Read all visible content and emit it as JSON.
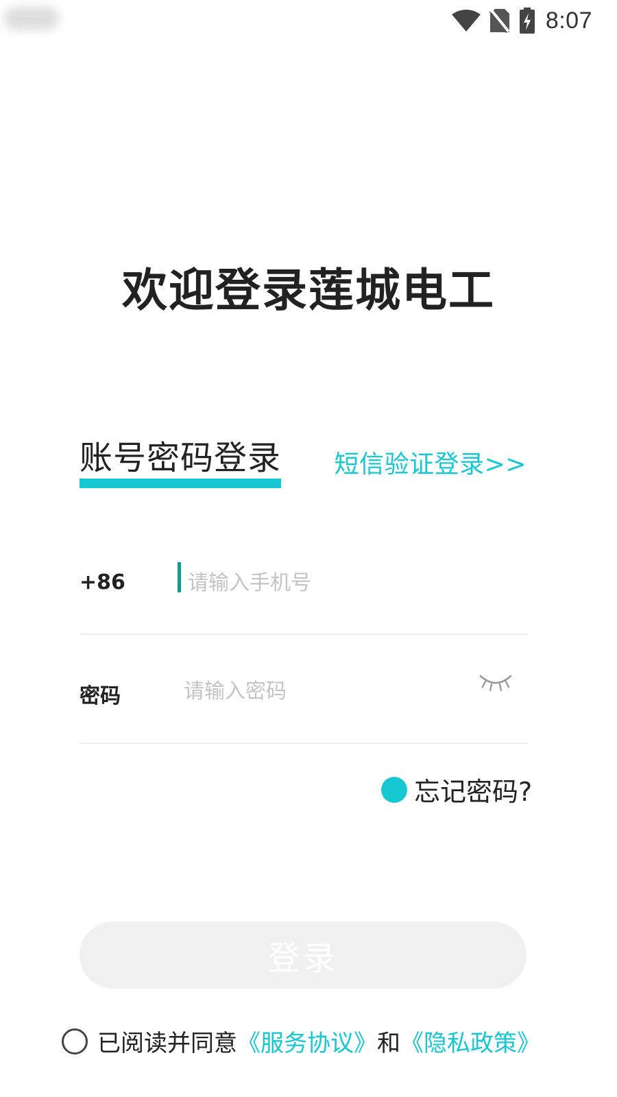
{
  "status_bar": {
    "time": "8:07",
    "icons": [
      "wifi-icon",
      "no-sim-icon",
      "battery-charging-icon"
    ]
  },
  "welcome_title": "欢迎登录莲城电工",
  "tabs": {
    "active_label": "账号密码登录",
    "sms_label": "短信验证登录>>"
  },
  "phone_field": {
    "label": "+86",
    "placeholder": "请输入手机号",
    "value": ""
  },
  "password_field": {
    "label": "密码",
    "placeholder": "请输入密码",
    "value": "",
    "toggle_icon": "eye-closed-icon"
  },
  "forgot_password": "忘记密码?",
  "login_button": "登录",
  "agreement": {
    "prefix": "已阅读并同意",
    "service_link": "《服务协议》",
    "conjunction": "和",
    "privacy_link": "《隐私政策》",
    "checked": false
  },
  "colors": {
    "accent": "#16c8d2",
    "cursor": "#0d9e8e",
    "text": "#222222",
    "placeholder": "#c4c4c4",
    "divider": "#eeeeee",
    "button_disabled_bg": "#f0f0f0"
  }
}
